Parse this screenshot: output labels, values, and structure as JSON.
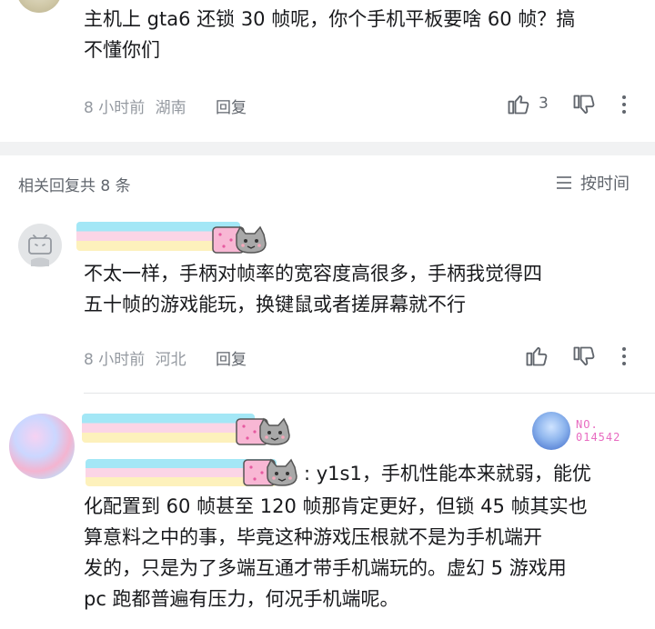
{
  "top_comment": {
    "text_line1": "主机上 gta6 还锁 30 帧呢，你个手机平板要啥 60 帧？搞",
    "text_line2": "不懂你们",
    "time": "8 小时前",
    "location": "湖南",
    "reply_label": "回复",
    "like_count": "3"
  },
  "replies_header": {
    "title": "相关回复共 8 条",
    "sort_label": "按时间"
  },
  "reply1": {
    "text_line1": "不太一样，手柄对帧率的宽容度高很多，手柄我觉得四",
    "text_line2": "五十帧的游戏能玩，换键鼠或者搓屏幕就不行",
    "time": "8 小时前",
    "location": "河北",
    "reply_label": "回复"
  },
  "reply2": {
    "medal_label_line1": "NO.",
    "medal_label_line2": "014542",
    "text_line1_suffix": ": y1s1，手机性能本来就弱，能优",
    "text_line2": "化配置到 60 帧甚至 120 帧那肯定更好，但锁 45 帧其实也",
    "text_line3": "算意料之中的事，毕竟这种游戏压根就不是为手机端开",
    "text_line4": "发的，只是为了多端互通才带手机端玩的。虚幻 5 游戏用",
    "text_line5": "pc 跑都普遍有压力，何况手机端呢。"
  },
  "colors": {
    "text_primary": "#18191c",
    "text_meta": "#9499a0",
    "text_secondary": "#61666d",
    "band": "#f1f2f3",
    "rainbow_blue": "#9ee6f5",
    "rainbow_pink": "#fbd3e5",
    "rainbow_yellow": "#fdf0b8"
  }
}
